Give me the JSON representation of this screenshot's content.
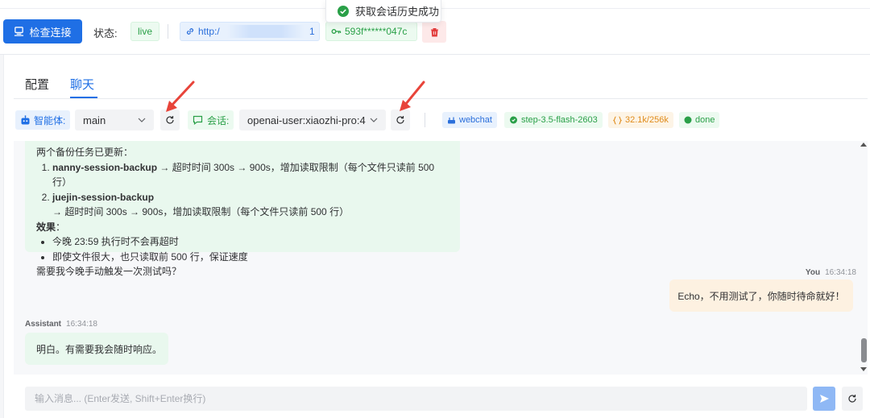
{
  "header": {
    "check_button": "检查连接",
    "status_label": "状态:",
    "status_value": "live",
    "url_prefix": "http:/",
    "url_suffix": "1",
    "api_key": "593f******047c"
  },
  "toast": {
    "message": "获取会话历史成功"
  },
  "tabs": [
    {
      "label": "配置"
    },
    {
      "label": "聊天"
    }
  ],
  "toolbar": {
    "agent_label": "智能体:",
    "agent_value": "main",
    "session_label": "会话:",
    "session_value": "openai-user:xiaozhi-pro:4",
    "chips": {
      "channel": "webchat",
      "model": "step-3.5-flash-2603",
      "tokens": "32.1k/256k",
      "state": "done"
    }
  },
  "messages": {
    "assistant_1": {
      "intro": "两个备份任务已更新：",
      "items": [
        {
          "name": "nanny-session-backup",
          "text": " → 超时时间 300s → 900s，增加读取限制（每个文件只读前 500 行）"
        },
        {
          "name": "juejin-session-backup",
          "text": " → 超时时间 300s → 900s，增加读取限制（每个文件只读前 500 行）"
        }
      ],
      "effect_title": "效果",
      "effect_colon": "：",
      "effects": [
        "今晚 23:59 执行时不会再超时",
        "即使文件很大，也只读取前 500 行，保证速度"
      ],
      "question": "需要我今晚手动触发一次测试吗？"
    },
    "user": {
      "role": "You",
      "time": "16:34:18",
      "text": "Echo，不用测试了，你随时待命就好！"
    },
    "assistant_2": {
      "role": "Assistant",
      "time": "16:34:18",
      "text": "明白。有需要我会随时响应。"
    }
  },
  "composer": {
    "placeholder": "输入消息... (Enter发送, Shift+Enter换行)"
  },
  "colors": {
    "primary": "#1f6fe5",
    "success": "#2aa048",
    "warning": "#e08b1a",
    "danger": "#e23c3c",
    "annotation": "#e8443a"
  }
}
